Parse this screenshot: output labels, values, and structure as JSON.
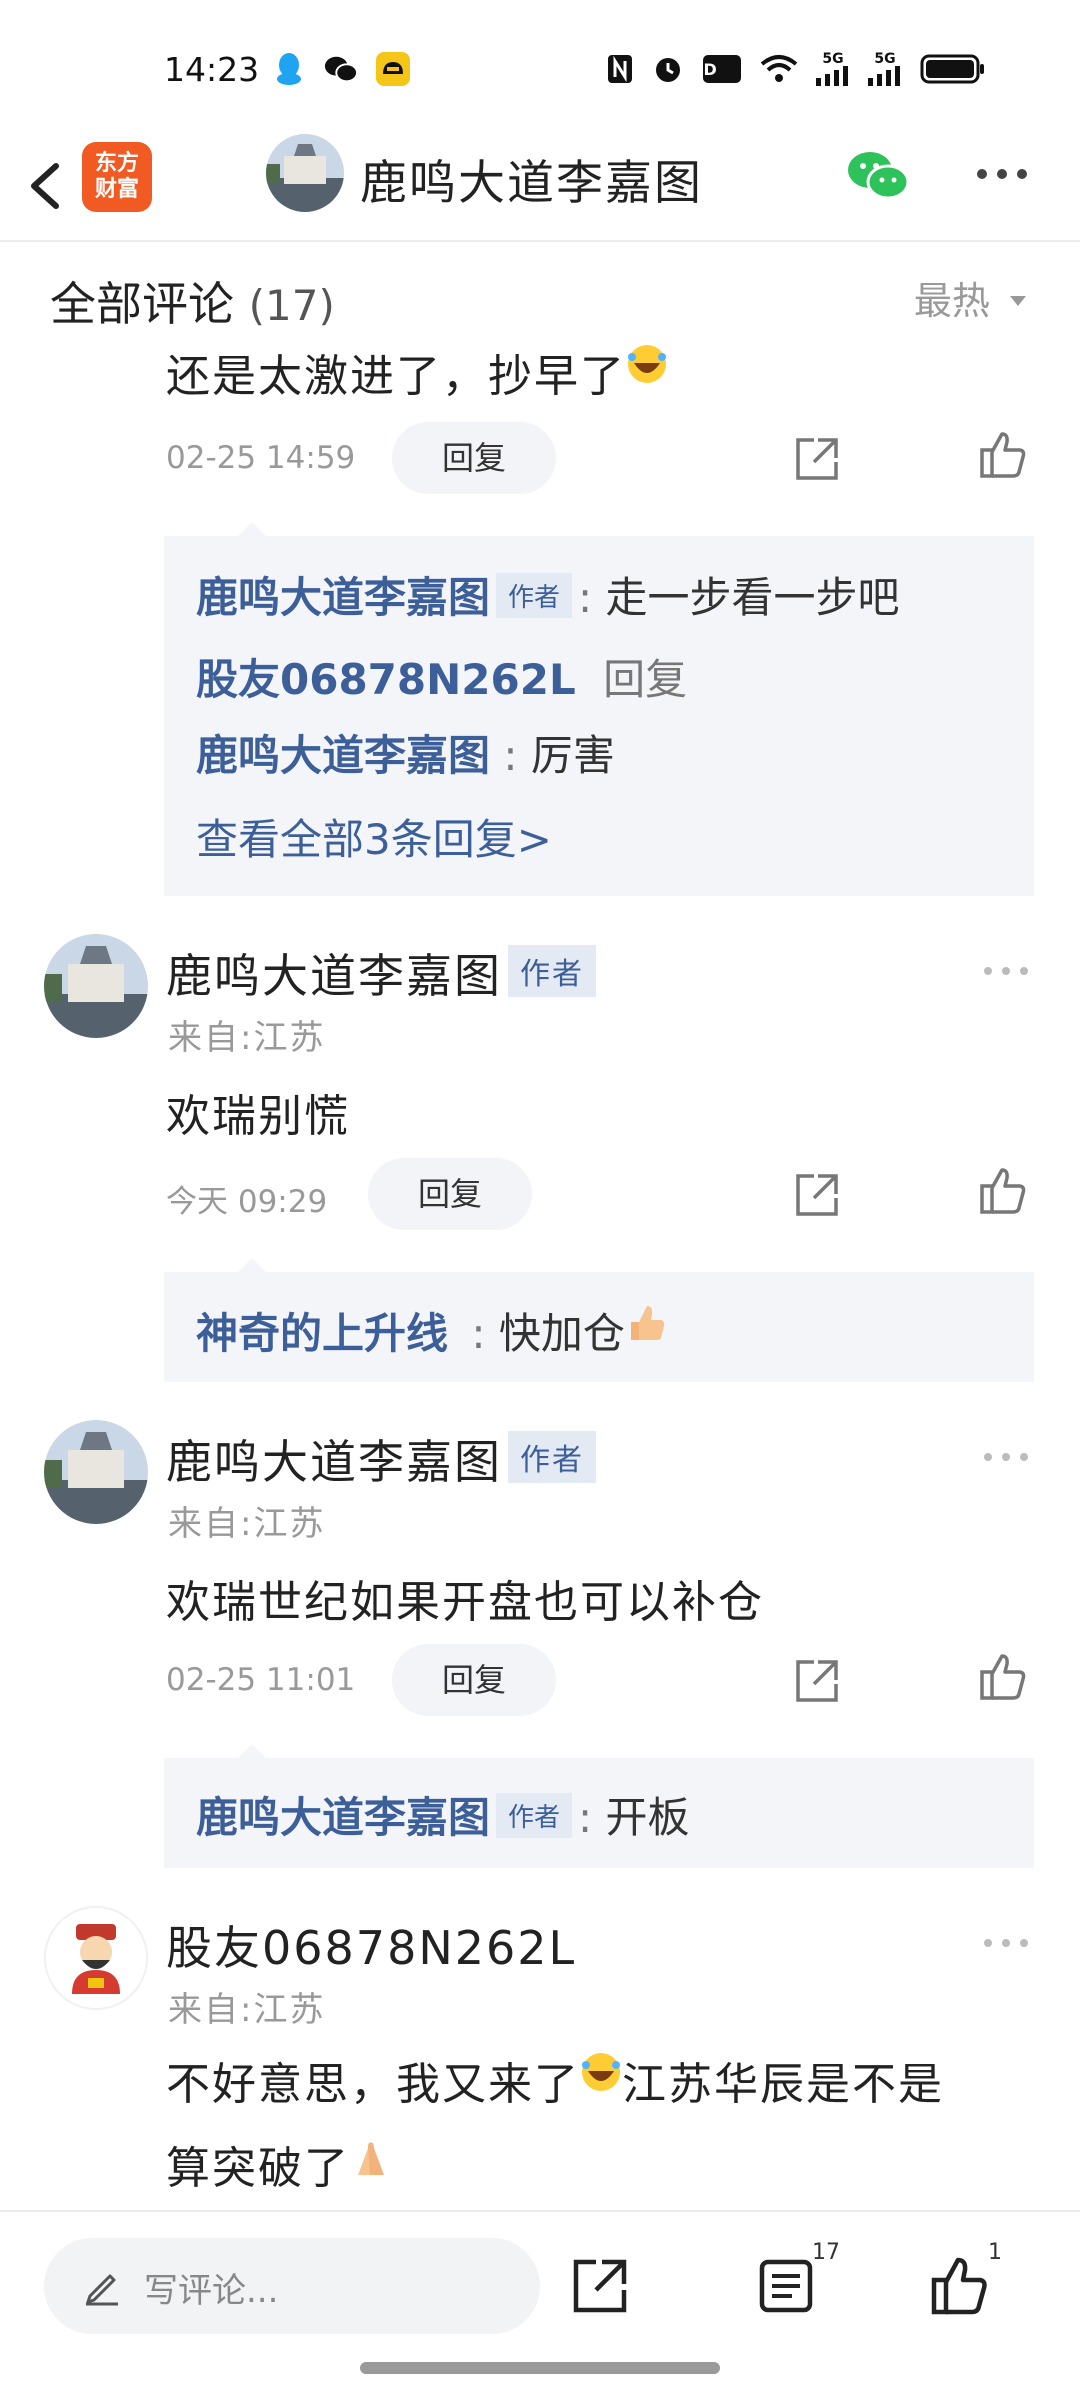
{
  "status_bar": {
    "time": "14:23",
    "icons": [
      "qq-icon",
      "wechat-icon",
      "car-app-icon",
      "nfc-icon",
      "alarm-icon",
      "hd-icon",
      "wifi-icon",
      "signal-5g-icon",
      "signal-5g-icon",
      "battery-icon"
    ],
    "hd_label": "HD",
    "net_label_1": "5G",
    "net_label_2": "5G"
  },
  "header": {
    "brand_line1": "东方",
    "brand_line2": "财富",
    "title": "鹿鸣大道李嘉图"
  },
  "section": {
    "title": "全部评论",
    "count": "(17)",
    "sort_label": "最热"
  },
  "top_comment": {
    "text": "还是太激进了，抄早了",
    "time": "02-25 14:59",
    "reply_label": "回复",
    "replies": [
      {
        "user": "鹿鸣大道李嘉图",
        "tag": "作者",
        "sep": ":",
        "text": "走一步看一步吧"
      },
      {
        "user": "股友06878N262L",
        "text": "回复"
      },
      {
        "user": "鹿鸣大道李嘉图",
        "sep": ":",
        "text": "厉害"
      }
    ],
    "view_all": "查看全部3条回复>"
  },
  "comments": [
    {
      "user": "鹿鸣大道李嘉图",
      "tag": "作者",
      "location": "来自:江苏",
      "text": "欢瑞别慌",
      "time": "今天 09:29",
      "reply_label": "回复",
      "reply": {
        "user": "神奇的上升线",
        "sep": ":",
        "text": "快加仓"
      }
    },
    {
      "user": "鹿鸣大道李嘉图",
      "tag": "作者",
      "location": "来自:江苏",
      "text": "欢瑞世纪如果开盘也可以补仓",
      "time": "02-25 11:01",
      "reply_label": "回复",
      "reply": {
        "user": "鹿鸣大道李嘉图",
        "tag": "作者",
        "sep": ":",
        "text": "开板"
      }
    },
    {
      "user": "股友06878N262L",
      "location": "来自:江苏",
      "text_line1": "不好意思，我又来了",
      "text_line1b": "江苏华辰是不是",
      "text_line2": "算突破了"
    }
  ],
  "bottom_bar": {
    "placeholder": "写评论...",
    "comment_count": "17",
    "like_count": "1"
  },
  "colors": {
    "brand": "#f15a22",
    "link_blue": "#3d5f99",
    "wechat_green": "#2ec25b"
  }
}
